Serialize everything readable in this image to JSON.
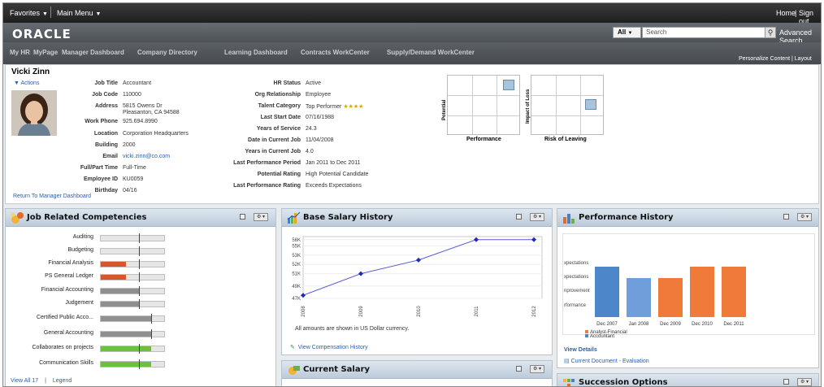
{
  "topbar": {
    "favorites": "Favorites",
    "main_menu": "Main Menu",
    "home": "Home",
    "sign_out": "Sign out",
    "divider": "|"
  },
  "brand": {
    "logo": "ORACLE"
  },
  "search": {
    "scope": "All",
    "placeholder": "Search",
    "advanced": "Advanced Search"
  },
  "nav": {
    "tabs": [
      "My HR",
      "MyPage",
      "Manager Dashboard",
      "Company Directory",
      "Learning Dashboard",
      "Contracts WorkCenter",
      "Supply/Demand WorkCenter"
    ],
    "personalize": "Personalize Content",
    "layout": "Layout",
    "divider": "|"
  },
  "profile": {
    "name": "Vicki Zinn",
    "actions": "Actions",
    "return_link": "Return To Manager Dashboard",
    "left_fields": [
      {
        "label": "Job Title",
        "value": "Accountant"
      },
      {
        "label": "Job Code",
        "value": "110000"
      },
      {
        "label": "Address",
        "value": "5815 Owens Dr",
        "value2": "Pleasanton, CA 94588"
      },
      {
        "label": "Work Phone",
        "value": "925.694.8990"
      },
      {
        "label": "Location",
        "value": "Corporation Headquarters"
      },
      {
        "label": "Building",
        "value": "2000"
      },
      {
        "label": "Email",
        "value": "vicki.zinn@co.com"
      },
      {
        "label": "Full/Part Time",
        "value": "Full-Time"
      },
      {
        "label": "Employee ID",
        "value": "KU0059"
      },
      {
        "label": "Birthday",
        "value": "04/16"
      }
    ],
    "right_fields": [
      {
        "label": "HR Status",
        "value": "Active"
      },
      {
        "label": "Org Relationship",
        "value": "Employee"
      },
      {
        "label": "Talent Category",
        "value": "Top Performer"
      },
      {
        "label": "Last Start Date",
        "value": "07/16/1988"
      },
      {
        "label": "Years of Service",
        "value": "24.3"
      },
      {
        "label": "Date in Current Job",
        "value": "11/04/2008"
      },
      {
        "label": "Years in Current Job",
        "value": "4.0"
      },
      {
        "label": "Last Performance Period",
        "value": "Jan 2011 to Dec 2011"
      },
      {
        "label": "Potential Rating",
        "value": "High Potential Candidate"
      },
      {
        "label": "Last Performance Rating",
        "value": "Exceeds Expectations"
      }
    ],
    "talent_stars": "★★★★",
    "grid1": {
      "ylabel": "Potential",
      "xlabel": "Performance"
    },
    "grid2": {
      "ylabel": "Impact of Loss",
      "xlabel": "Risk of Leaving"
    }
  },
  "competencies": {
    "title": "Job Related Competencies",
    "menu": "⚙ ▾",
    "view_all": "View All 17",
    "legend": "Legend",
    "divider": "|",
    "items": [
      {
        "label": "Auditing",
        "fill": 0,
        "color": "#e6e6e6",
        "mark": 0.6
      },
      {
        "label": "Budgeting",
        "fill": 0,
        "color": "#e6e6e6",
        "mark": 0.6
      },
      {
        "label": "Financial Analysis",
        "fill": 0.4,
        "color": "#d9552e",
        "mark": 0.6
      },
      {
        "label": "PS General Ledger",
        "fill": 0.4,
        "color": "#d9552e",
        "mark": 0.6
      },
      {
        "label": "Financial Accounting",
        "fill": 0.6,
        "color": "#8f8f8f",
        "mark": 0.6
      },
      {
        "label": "Judgement",
        "fill": 0.6,
        "color": "#8f8f8f",
        "mark": 0.6
      },
      {
        "label": "Certified Public Acco...",
        "fill": 0.8,
        "color": "#8f8f8f",
        "mark": 0.8
      },
      {
        "label": "General Accounting",
        "fill": 0.8,
        "color": "#8f8f8f",
        "mark": 0.8
      },
      {
        "label": "Collaborates on projects",
        "fill": 0.8,
        "color": "#6fbf3f",
        "mark": 0.6
      },
      {
        "label": "Communication Skills",
        "fill": 0.8,
        "color": "#6fbf3f",
        "mark": 0.6
      }
    ]
  },
  "salary": {
    "title": "Base Salary History",
    "menu": "⚙ ▾",
    "note": "All amounts are shown in US Dollar currency.",
    "link": "View Compensation History"
  },
  "chart_data": [
    {
      "type": "line",
      "x": [
        "2008",
        "2009",
        "2010",
        "2011",
        "2012"
      ],
      "y_ticks": [
        "47K",
        "49K",
        "51K",
        "52K",
        "53K",
        "55K",
        "56K"
      ],
      "values": [
        47.5,
        51,
        53.2,
        56.5,
        56.5
      ],
      "ylim": [
        47,
        57
      ],
      "color": "#5b5fd6"
    },
    {
      "type": "bar",
      "categories": [
        "Dec 2007",
        "Jan 2008",
        "Dec 2009",
        "Dec 2010",
        "Dec 2011"
      ],
      "values": [
        4,
        3,
        3,
        4,
        4
      ],
      "colors": [
        "#4d86c9",
        "#6f9edb",
        "#f07a3a",
        "#f07a3a",
        "#f07a3a"
      ],
      "y_tick_labels": [
        "xpectations",
        "xpectations",
        "nprovement",
        "rformance"
      ],
      "legend": [
        "Analyst-Financial",
        "Accountant"
      ],
      "legend_colors": [
        "#f07a3a",
        "#4d86c9"
      ]
    }
  ],
  "performance": {
    "title": "Performance History",
    "menu": "⚙ ▾",
    "view_details": "View Details",
    "doc_link": "Current Document - Evaluation"
  },
  "current_salary": {
    "title": "Current Salary",
    "menu": "⚙ ▾"
  },
  "succession": {
    "title": "Succession Options",
    "menu": "⚙ ▾"
  }
}
